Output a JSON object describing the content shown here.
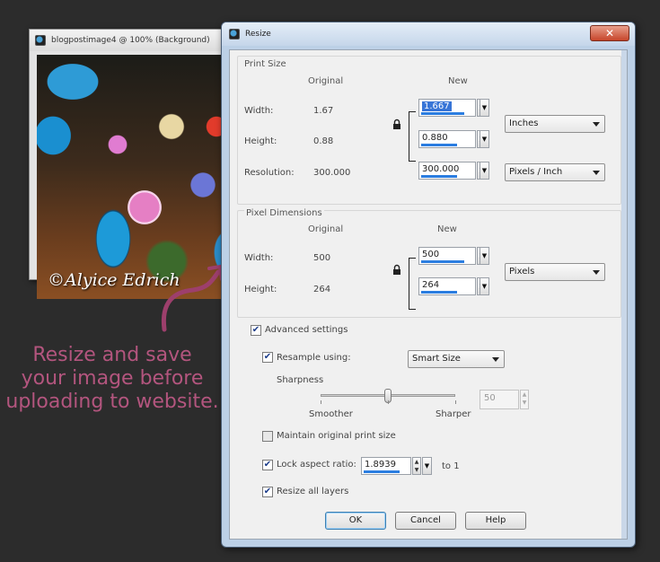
{
  "image_window": {
    "title": "blogpostimage4 @ 100% (Background)",
    "watermark": "©Alyice Edrich"
  },
  "annotation": {
    "lines": [
      "Resize and save",
      "your image before",
      "uploading to website."
    ],
    "color": "#b3557e"
  },
  "dialog": {
    "title": "Resize",
    "close_label": "✕",
    "print_size": {
      "group_label": "Print Size",
      "original_header": "Original",
      "new_header": "New",
      "width_label": "Width:",
      "width_original": "1.67",
      "width_new": "1.667",
      "height_label": "Height:",
      "height_original": "0.88",
      "height_new": "0.880",
      "units": "Inches",
      "resolution_label": "Resolution:",
      "resolution_original": "300.000",
      "resolution_new": "300.000",
      "resolution_units": "Pixels / Inch"
    },
    "pixel_dimensions": {
      "group_label": "Pixel Dimensions",
      "original_header": "Original",
      "new_header": "New",
      "width_label": "Width:",
      "width_original": "500",
      "width_new": "500",
      "height_label": "Height:",
      "height_original": "264",
      "height_new": "264",
      "units": "Pixels"
    },
    "advanced_settings": {
      "label": "Advanced settings",
      "checked": true
    },
    "resample": {
      "label": "Resample using:",
      "checked": true,
      "method": "Smart Size"
    },
    "sharpness": {
      "label": "Sharpness",
      "left_label": "Smoother",
      "right_label": "Sharper",
      "value": "50",
      "level": 0.5
    },
    "maintain_print_size": {
      "label": "Maintain original print size",
      "checked": false
    },
    "lock_aspect": {
      "label": "Lock aspect ratio:",
      "checked": true,
      "value": "1.8939",
      "suffix": "to 1"
    },
    "resize_all_layers": {
      "label": "Resize all layers",
      "checked": true
    },
    "buttons": {
      "ok": "OK",
      "cancel": "Cancel",
      "help": "Help"
    }
  },
  "icons": [
    "app-icon",
    "lock-icon",
    "close-icon",
    "dropdown-arrow-icon",
    "spin-up-icon",
    "spin-down-icon",
    "check-icon",
    "curved-arrow-icon"
  ]
}
